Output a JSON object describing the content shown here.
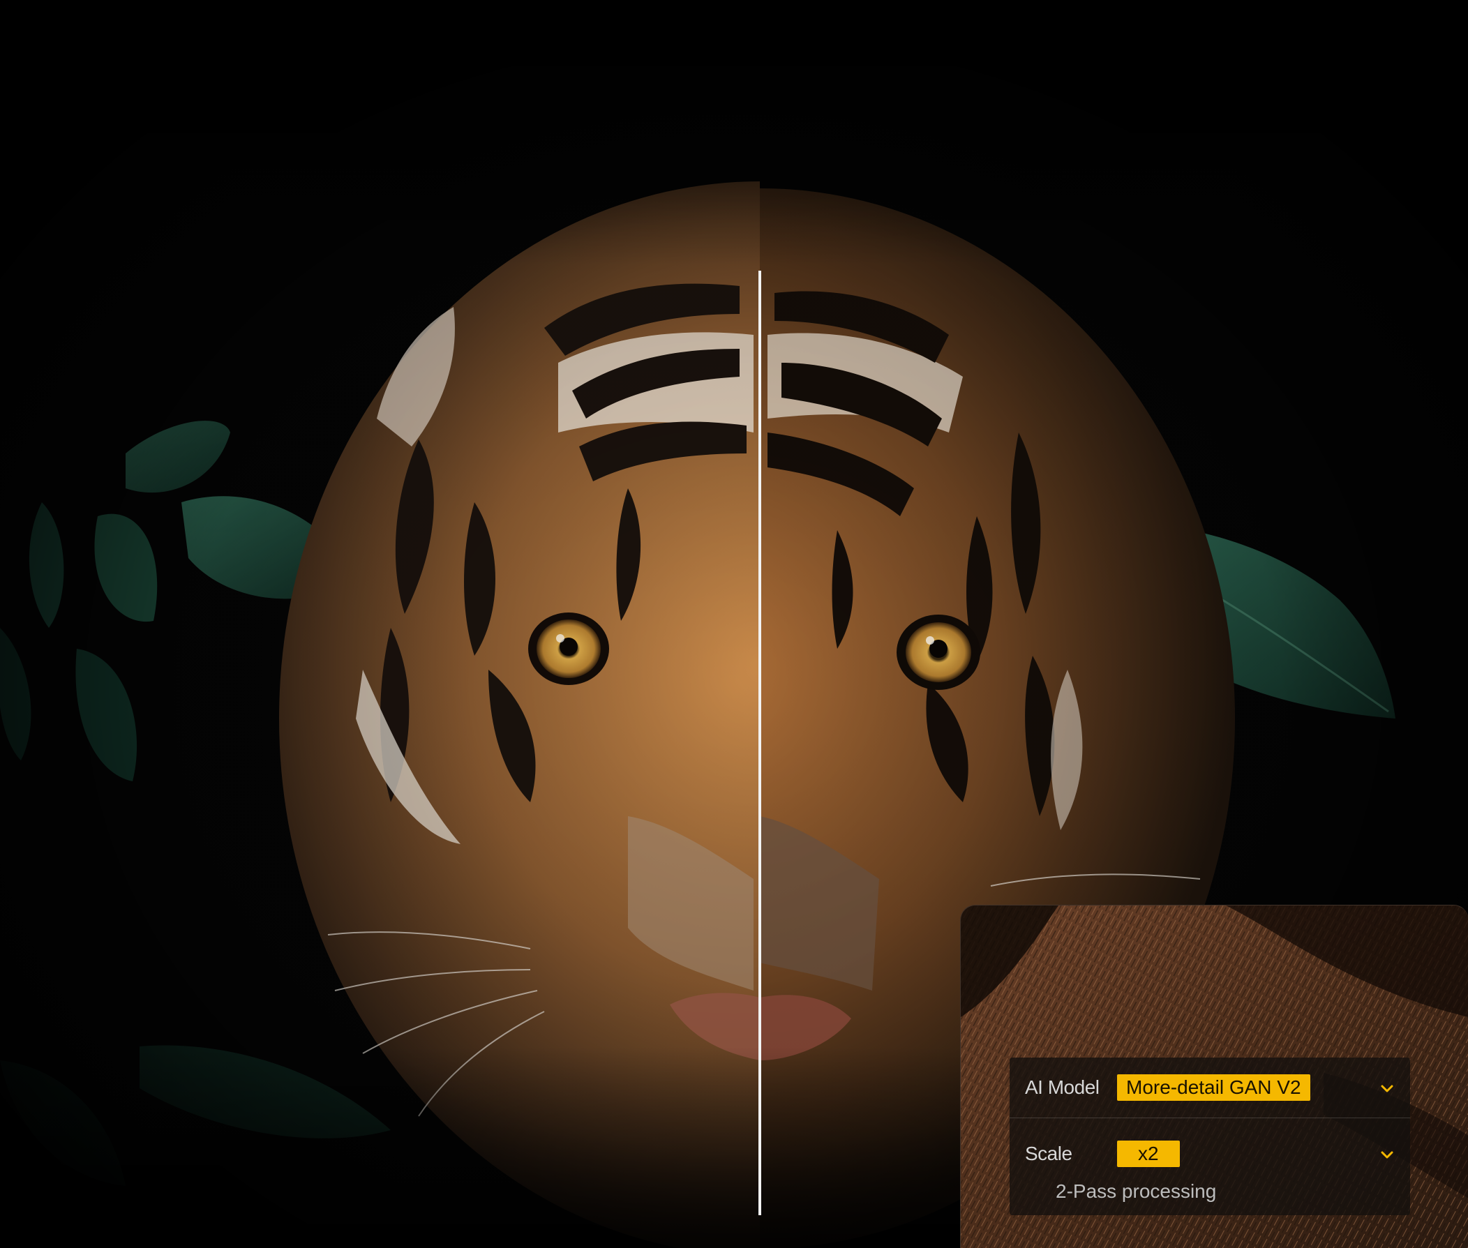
{
  "settings": {
    "ai_model": {
      "label": "AI Model",
      "selected": "More-detail GAN V2"
    },
    "scale": {
      "label": "Scale",
      "selected": "x2"
    },
    "two_pass": {
      "label": "2-Pass processing"
    }
  },
  "colors": {
    "accent": "#f5b800",
    "background": "#000000"
  },
  "icons": {
    "chevron": "chevron-down-icon"
  }
}
